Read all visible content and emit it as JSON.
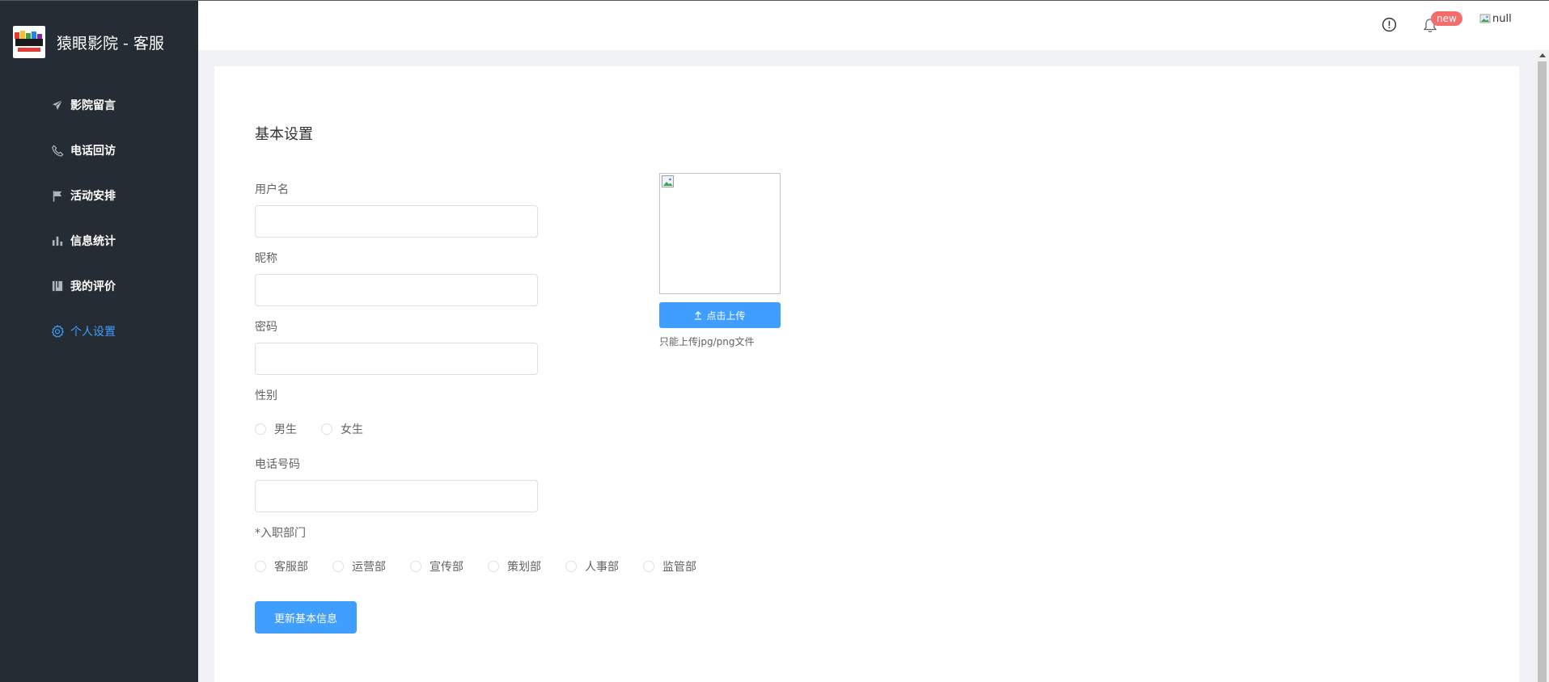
{
  "app": {
    "title": "猿眼影院 - 客服"
  },
  "sidebar": {
    "items": [
      {
        "label": "影院留言",
        "icon": "paper-plane-icon"
      },
      {
        "label": "电话回访",
        "icon": "phone-icon"
      },
      {
        "label": "活动安排",
        "icon": "flag-icon"
      },
      {
        "label": "信息统计",
        "icon": "bar-chart-icon"
      },
      {
        "label": "我的评价",
        "icon": "notebook-icon"
      },
      {
        "label": "个人设置",
        "icon": "gear-icon",
        "active": true
      }
    ]
  },
  "header": {
    "badge": "new",
    "avatar_alt": "null"
  },
  "form": {
    "title": "基本设置",
    "username_label": "用户名",
    "username_value": "",
    "nickname_label": "昵称",
    "nickname_value": "",
    "password_label": "密码",
    "password_value": "",
    "gender_label": "性别",
    "gender_options": [
      "男生",
      "女生"
    ],
    "phone_label": "电话号码",
    "phone_value": "",
    "department_label": "*入职部门",
    "department_options": [
      "客服部",
      "运营部",
      "宣传部",
      "策划部",
      "人事部",
      "监管部"
    ],
    "submit_label": "更新基本信息"
  },
  "upload": {
    "button_label": "点击上传",
    "tip": "只能上传jpg/png文件"
  },
  "colors": {
    "sidebar_bg": "#262c33",
    "accent": "#409eff",
    "badge": "#f56c6c"
  }
}
